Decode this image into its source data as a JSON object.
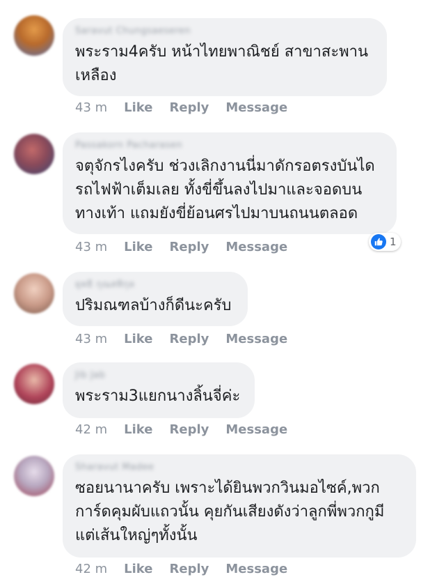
{
  "comments": [
    {
      "author": "Saravut Chungsaeseren",
      "text": "พระราม4ครับ หน้าไทยพาณิชย์ สาขาสะพาน\nเหลือง",
      "time": "43 m",
      "like": "Like",
      "reply": "Reply",
      "message": "Message",
      "avatar_colors": [
        "#c9782e",
        "#5b6fa8"
      ]
    },
    {
      "author": "Passakorn Pacharasen",
      "text": "จตุจักรไงครับ ช่วงเลิกงานนี่มาดักรอตรงบันได\nรถไฟฟ้าเต็มเลย ทั้งขี่ขึ้นลงไปมาและจอดบน\nทางเท้า แถมยังขี่ย้อนศรไปมาบนถนนตลอด",
      "time": "43 m",
      "like": "Like",
      "reply": "Reply",
      "message": "Message",
      "reaction_count": "1",
      "avatar_colors": [
        "#b35a5a",
        "#4a4e7a"
      ]
    },
    {
      "author": "ยุทธิ กุณสทิกุล",
      "text": "ปริมณฑลบ้างก็ดีนะครับ",
      "time": "43 m",
      "like": "Like",
      "reply": "Reply",
      "message": "Message",
      "avatar_colors": [
        "#d9b6a6",
        "#8b6a5c"
      ]
    },
    {
      "author": "Jib Jab",
      "text": "พระราม3แยกนางลิ้นจี่ค่ะ",
      "time": "42 m",
      "like": "Like",
      "reply": "Reply",
      "message": "Message",
      "avatar_colors": [
        "#b0455a",
        "#d9a08a"
      ]
    },
    {
      "author": "Sharavut Madee",
      "text": "ซอยนานาครับ เพราะได้ยินพวกวินมอไซค์,พวก\nการ์ดคุมผับแถวนั้น คุยกันเสียงดังว่าลูกพี่พวกกูมี\nแต่เส้นใหญ่ๆทั้งนั้น",
      "time": "42 m",
      "like": "Like",
      "reply": "Reply",
      "message": "Message",
      "avatar_colors": [
        "#c8b8c8",
        "#a0445a"
      ]
    }
  ],
  "colors": {
    "bubble": "#f0f1f3",
    "text": "#1c1e21",
    "meta": "#8c939d",
    "like_blue": "#1877f2"
  }
}
